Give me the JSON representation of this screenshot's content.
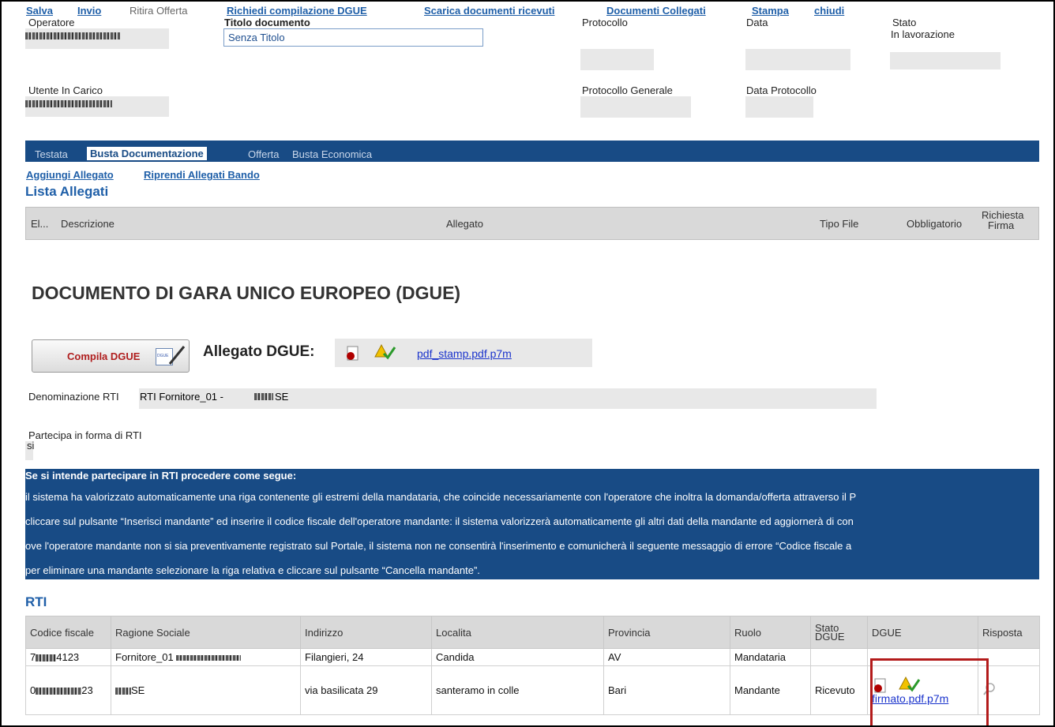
{
  "toolbar": {
    "salva": "Salva",
    "invio": "Invio",
    "ritira": "Ritira Offerta",
    "richiedi": "Richiedi compilazione DGUE",
    "scarica": "Scarica documenti ricevuti",
    "collegati": "Documenti Collegati",
    "stampa": "Stampa",
    "chiudi": "chiudi"
  },
  "header": {
    "operatore_label": "Operatore",
    "titolo_label": "Titolo documento",
    "titolo_value": "Senza Titolo",
    "protocollo_label": "Protocollo",
    "data_label": "Data",
    "stato_label": "Stato",
    "stato_value": "In lavorazione",
    "utente_label": "Utente In Carico",
    "protocollo_generale_label": "Protocollo Generale",
    "data_protocollo_label": "Data Protocollo"
  },
  "tabs": [
    "Testata",
    "Busta Documentazione",
    "Offerta",
    "Busta Economica"
  ],
  "allegati": {
    "aggiungi": "Aggiungi Allegato",
    "riprendi": "Riprendi Allegati Bando",
    "title": "Lista Allegati",
    "columns": [
      "El...",
      "Descrizione",
      "Allegato",
      "Tipo File",
      "Obbligatorio",
      "Richiesta",
      "Firma"
    ]
  },
  "dgue": {
    "title": "DOCUMENTO DI GARA UNICO EUROPEO (DGUE)",
    "compila_label": "Compila DGUE",
    "compila_icon_text": "DGUE",
    "allegato_label": "Allegato DGUE:",
    "allegato_file": "pdf_stamp.pdf.p7m",
    "denominazione_label": "Denominazione RTI",
    "denominazione_value": "RTI Fornitore_01  -  ",
    "denominazione_suffix": "SE",
    "partecipa_label": "Partecipa in forma di RTI",
    "partecipa_value": "si"
  },
  "banner": {
    "heading": "Se si intende partecipare in RTI procedere come segue:",
    "line1": "il sistema ha valorizzato automaticamente una riga contenente gli estremi della mandataria, che coincide necessariamente con l'operatore che inoltra la domanda/offerta attraverso il P",
    "line2": "cliccare sul pulsante “Inserisci mandante” ed inserire il codice fiscale dell'operatore mandante: il sistema valorizzerà automaticamente gli altri dati della mandante ed aggiornerà di con",
    "line3": "ove l'operatore mandante non si sia preventivamente registrato sul Portale, il sistema non ne consentirà l'inserimento e comunicherà il seguente messaggio di errore “Codice fiscale a",
    "line4": "per eliminare una mandante selezionare la riga relativa e cliccare sul pulsante “Cancella mandante”."
  },
  "rti": {
    "title": "RTI",
    "columns": [
      "Codice fiscale",
      "Ragione Sociale",
      "Indirizzo",
      "Localita",
      "Provincia",
      "Ruolo",
      "Stato DGUE",
      "DGUE",
      "Risposta"
    ],
    "rows": [
      {
        "cf_prefix": "7",
        "cf_suffix": "4123",
        "ragione": "Fornitore_01",
        "indirizzo": "Filangieri, 24",
        "localita": "Candida",
        "provincia": "AV",
        "ruolo": "Mandataria",
        "stato": "",
        "dgue": ""
      },
      {
        "cf_prefix": "0",
        "cf_suffix": "23",
        "ragione": "SE",
        "indirizzo": "via basilicata 29",
        "localita": "santeramo in colle",
        "provincia": "Bari",
        "ruolo": "Mandante",
        "stato": "Ricevuto",
        "dgue": "firmato.pdf.p7m"
      }
    ]
  },
  "icons": {
    "signature": "signature-red-dot-icon",
    "verify": "verify-signature-icon",
    "magnifier": "magnifier-icon"
  }
}
